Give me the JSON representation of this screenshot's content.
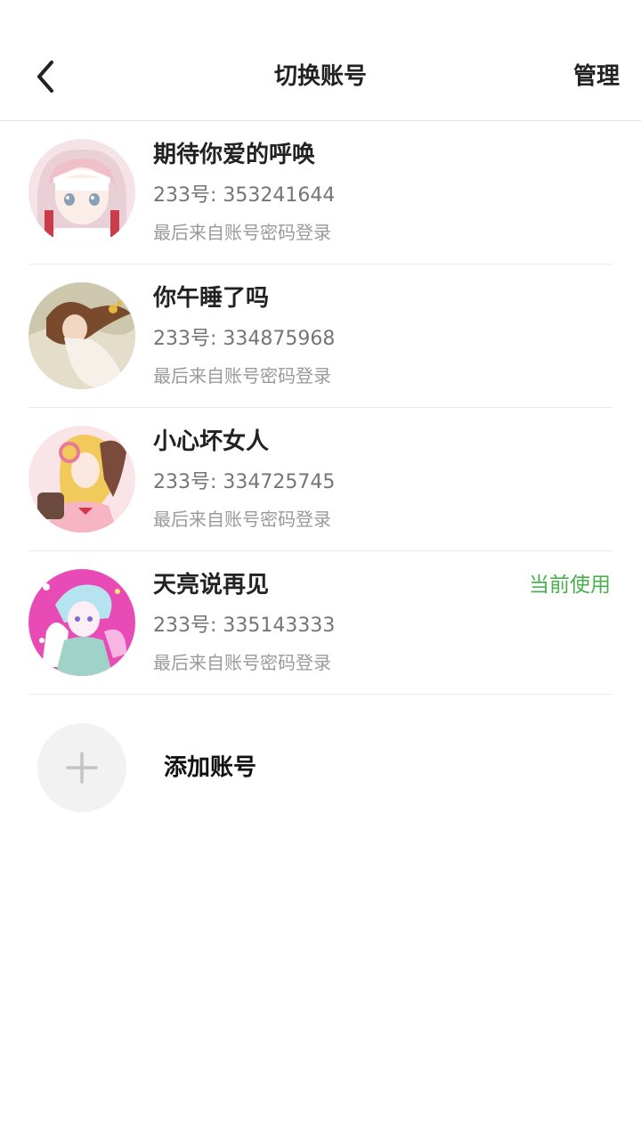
{
  "header": {
    "title": "切换账号",
    "manage_label": "管理",
    "back_icon": "chevron-left-icon"
  },
  "accounts": [
    {
      "name": "期待你爱的呼唤",
      "id_text": "233号: 353241644",
      "login_text": "最后来自账号密码登录",
      "current": false,
      "avatar_colors": [
        "#f3d9dd",
        "#ffffff",
        "#c9b9c6"
      ]
    },
    {
      "name": "你午睡了吗",
      "id_text": "233号: 334875968",
      "login_text": "最后来自账号密码登录",
      "current": false,
      "avatar_colors": [
        "#cfcab0",
        "#8a5a3a",
        "#f3ece2"
      ]
    },
    {
      "name": "小心坏女人",
      "id_text": "233号: 334725745",
      "login_text": "最后来自账号密码登录",
      "current": false,
      "avatar_colors": [
        "#f8e1e6",
        "#f2c95b",
        "#f7b5c3"
      ]
    },
    {
      "name": "天亮说再见",
      "id_text": "233号: 335143333",
      "login_text": "最后来自账号密码登录",
      "current": true,
      "current_label": "当前使用",
      "avatar_colors": [
        "#e84bb6",
        "#b6e3f0",
        "#ffffff"
      ]
    }
  ],
  "add_account": {
    "label": "添加账号",
    "icon": "plus-icon"
  },
  "colors": {
    "accent_green": "#4caf50",
    "text_primary": "#222222",
    "text_secondary": "#757575",
    "text_tertiary": "#9a9a9a",
    "divider": "#ececec"
  }
}
